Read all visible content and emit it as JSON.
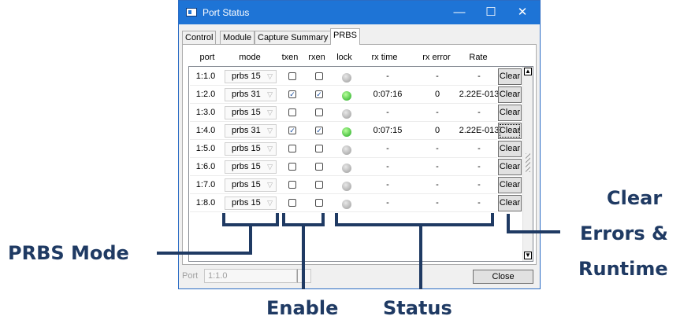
{
  "window": {
    "title": "Port Status",
    "minimize": "—",
    "maximize": "☐",
    "close": "✕"
  },
  "tabs": [
    {
      "label": "Control",
      "active": false
    },
    {
      "label": "Module",
      "active": false
    },
    {
      "label": "Capture Summary",
      "active": false
    },
    {
      "label": "PRBS",
      "active": true
    }
  ],
  "columns": [
    "port",
    "mode",
    "txen",
    "rxen",
    "lock",
    "rx time",
    "rx error",
    "Rate"
  ],
  "rows": [
    {
      "port": "1:1.0",
      "mode": "prbs 15",
      "txen": false,
      "rxen": false,
      "lock": false,
      "rx_time": "-",
      "rx_error": "-",
      "rate": "-",
      "clear": "Clear"
    },
    {
      "port": "1:2.0",
      "mode": "prbs 31",
      "txen": true,
      "rxen": true,
      "lock": true,
      "rx_time": "0:07:16",
      "rx_error": "0",
      "rate": "2.22E-013",
      "clear": "Clear"
    },
    {
      "port": "1:3.0",
      "mode": "prbs 15",
      "txen": false,
      "rxen": false,
      "lock": false,
      "rx_time": "-",
      "rx_error": "-",
      "rate": "-",
      "clear": "Clear"
    },
    {
      "port": "1:4.0",
      "mode": "prbs 31",
      "txen": true,
      "rxen": true,
      "lock": true,
      "rx_time": "0:07:15",
      "rx_error": "0",
      "rate": "2.22E-013",
      "clear": "Clear"
    },
    {
      "port": "1:5.0",
      "mode": "prbs 15",
      "txen": false,
      "rxen": false,
      "lock": false,
      "rx_time": "-",
      "rx_error": "-",
      "rate": "-",
      "clear": "Clear"
    },
    {
      "port": "1:6.0",
      "mode": "prbs 15",
      "txen": false,
      "rxen": false,
      "lock": false,
      "rx_time": "-",
      "rx_error": "-",
      "rate": "-",
      "clear": "Clear"
    },
    {
      "port": "1:7.0",
      "mode": "prbs 15",
      "txen": false,
      "rxen": false,
      "lock": false,
      "rx_time": "-",
      "rx_error": "-",
      "rate": "-",
      "clear": "Clear"
    },
    {
      "port": "1:8.0",
      "mode": "prbs 15",
      "txen": false,
      "rxen": false,
      "lock": false,
      "rx_time": "-",
      "rx_error": "-",
      "rate": "-",
      "clear": "Clear"
    }
  ],
  "bottom": {
    "port_label": "Port",
    "port_value": "1:1.0",
    "close_label": "Close"
  },
  "annotations": {
    "prbs_mode": "PRBS Mode",
    "enable": "Enable",
    "status": "Status",
    "clear_line1": "Clear",
    "clear_line2": "Errors &",
    "clear_line3": "Runtime"
  },
  "colors": {
    "titlebar": "#1e74d6",
    "annotation": "#1f3a63",
    "lock_on": "#1fa81f",
    "lock_off": "#9a9a9a"
  }
}
